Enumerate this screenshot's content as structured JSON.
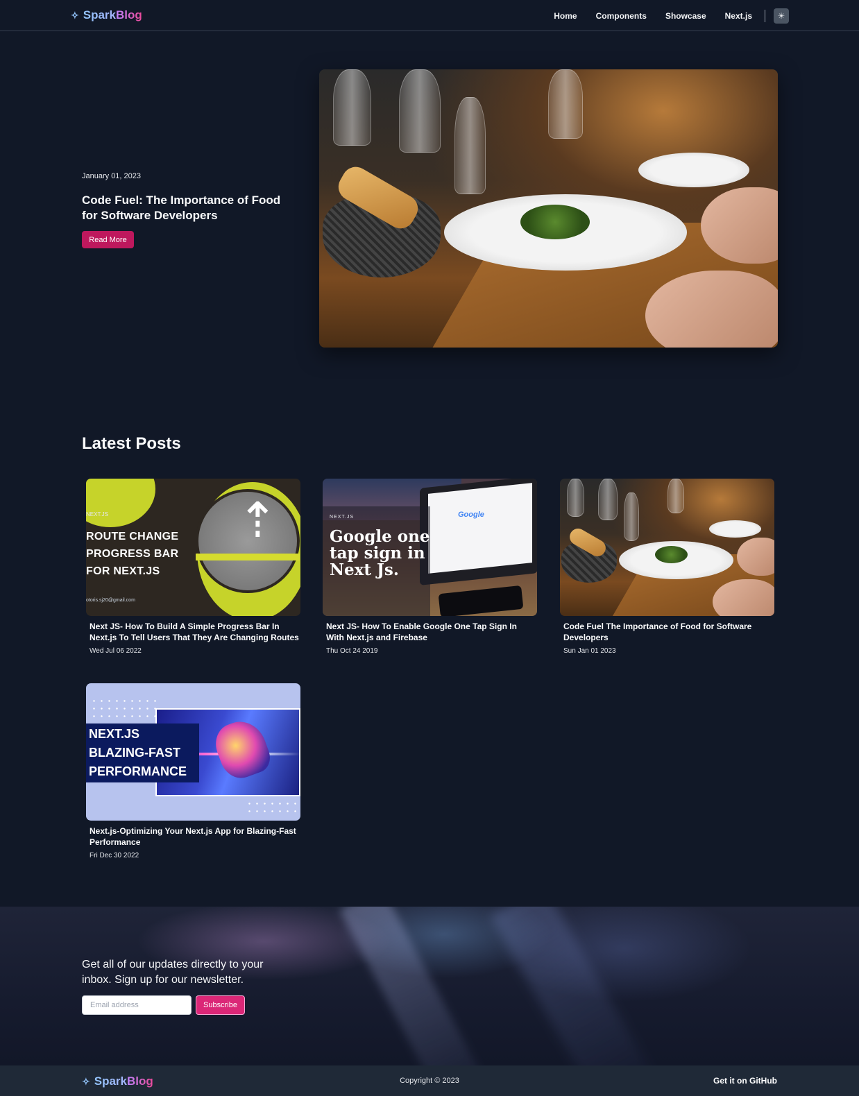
{
  "header": {
    "brand_part1": "Spark",
    "brand_part2": "Blog",
    "nav": [
      "Home",
      "Components",
      "Showcase",
      "Next.js"
    ],
    "theme_icon": "sun-icon"
  },
  "hero": {
    "date": "January 01, 2023",
    "title": "Code Fuel: The Importance of Food for Software Developers",
    "button": "Read More"
  },
  "latest": {
    "title": "Latest Posts",
    "posts": [
      {
        "title": "Next JS- How To Build A Simple Progress Bar In Next.js To Tell Users That They Are Changing Routes",
        "date": "Wed Jul 06 2022",
        "image_tag": "NEXT.JS",
        "image_text": [
          "ROUTE CHANGE",
          "PROGRESS BAR",
          "FOR NEXT.JS"
        ],
        "image_footer": "otoris.sj20@gmail.com"
      },
      {
        "title": "Next JS- How To Enable Google One Tap Sign In With Next.js and Firebase",
        "date": "Thu Oct 24 2019",
        "image_tag": "NEXT.JS",
        "image_text": [
          "Google one",
          "tap sign in",
          "Next Js."
        ],
        "image_logo": "Google"
      },
      {
        "title": "Code Fuel The Importance of Food for Software Developers",
        "date": "Sun Jan 01 2023"
      },
      {
        "title": "Next.js-Optimizing Your Next.js App for Blazing-Fast Performance",
        "date": "Fri Dec 30 2022",
        "image_text": [
          "NEXT.JS",
          "BLAZING-FAST",
          "PERFORMANCE"
        ]
      }
    ]
  },
  "newsletter": {
    "text": "Get all of our updates directly to your inbox. Sign up for our newsletter.",
    "placeholder": "Email address",
    "button": "Subscribe"
  },
  "footer": {
    "copyright": "Copyright © 2023",
    "github": "Get it on GitHub"
  },
  "colors": {
    "background": "#111827",
    "accent": "#be185d",
    "footer": "#1f2937"
  }
}
